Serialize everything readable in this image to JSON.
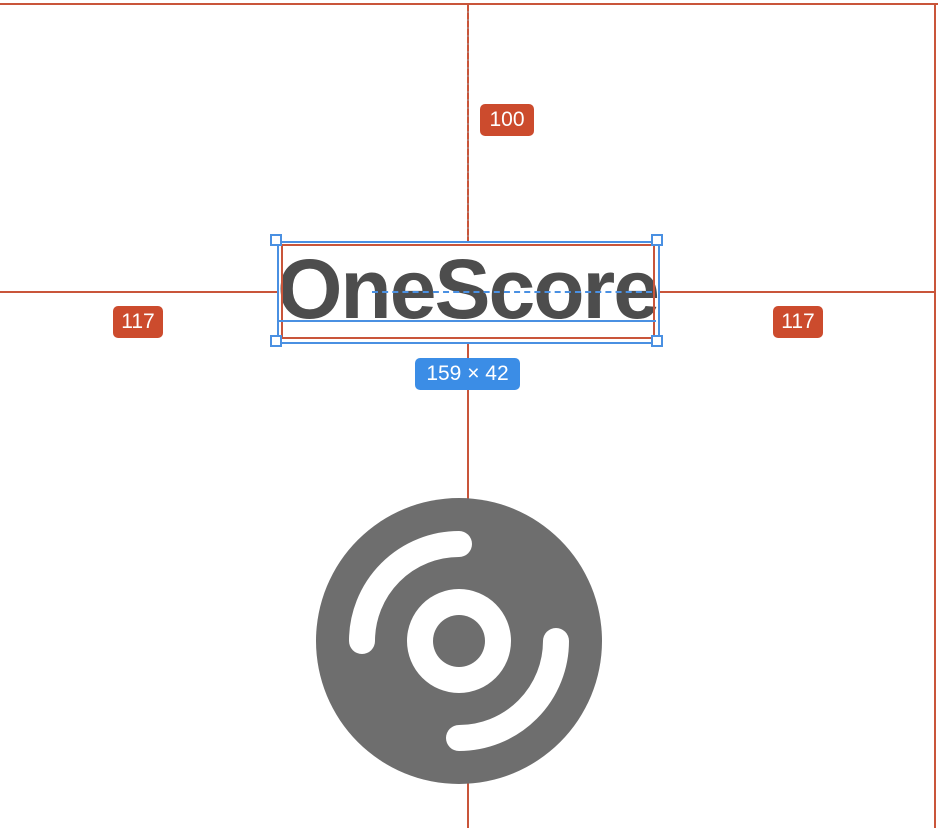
{
  "logo": {
    "text": "OneScore",
    "color": "#4d4d4d"
  },
  "measurements": {
    "top_spacing": "100",
    "left_spacing": "117",
    "right_spacing": "117",
    "selection_size": "159 × 42"
  },
  "icon": {
    "name": "disc-icon",
    "color": "#6e6e6e"
  },
  "colors": {
    "guide": "#c9553a",
    "spacing_badge": "#cc4b2d",
    "selection": "#4a90e2",
    "size_badge": "#3b8de6"
  }
}
